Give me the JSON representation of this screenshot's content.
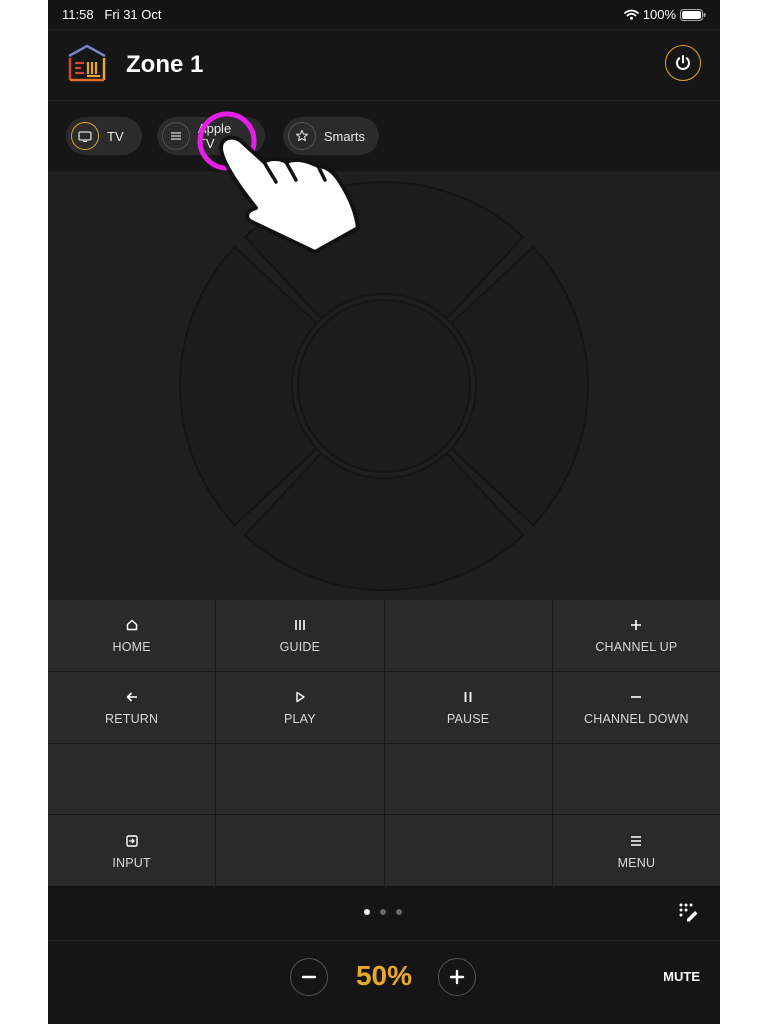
{
  "status_bar": {
    "time": "11:58",
    "date": "Fri 31 Oct",
    "battery": "100%"
  },
  "header": {
    "title": "Zone 1"
  },
  "sources": [
    {
      "label": "TV",
      "icon": "tv-icon",
      "active": true
    },
    {
      "label": "Apple TV",
      "icon": "menu-lines-icon",
      "active": false
    },
    {
      "label": "Smarts",
      "icon": "star-icon",
      "active": false
    }
  ],
  "buttons": {
    "home": "HOME",
    "guide": "GUIDE",
    "channel_up": "CHANNEL UP",
    "return": "RETURN",
    "play": "PLAY",
    "pause": "PAUSE",
    "channel_down": "CHANNEL DOWN",
    "input": "INPUT",
    "menu": "MENU"
  },
  "pager": {
    "pages": 3,
    "current": 1
  },
  "volume": {
    "level": "50%",
    "mute_label": "MUTE"
  },
  "colors": {
    "accent": "#e0a422",
    "volume": "#e8a928",
    "touch_highlight": "#e61ee6"
  }
}
